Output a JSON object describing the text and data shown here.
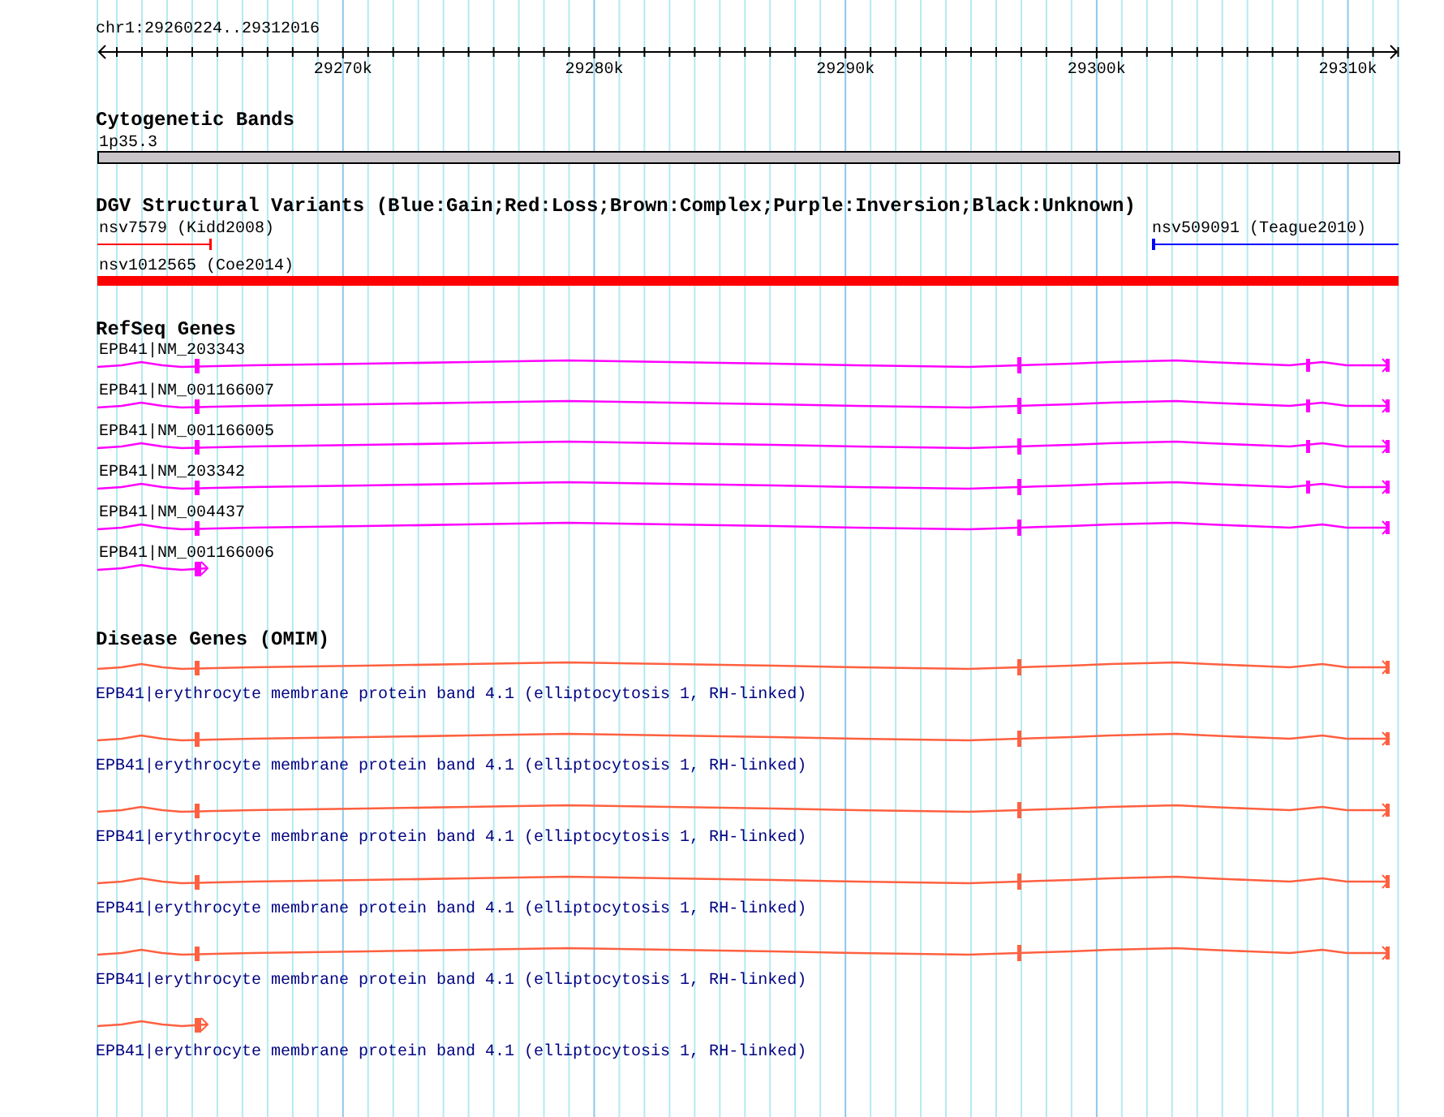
{
  "ruler": {
    "location": "chr1:29260224..29312016",
    "ticks": [
      "29270k",
      "29280k",
      "29290k",
      "29300k",
      "29310k"
    ]
  },
  "tracks": [
    {
      "kind": "bands",
      "title": "Cytogenetic Bands",
      "features": [
        {
          "label": "1p35.3"
        }
      ]
    },
    {
      "kind": "variants",
      "title": "DGV Structural Variants (Blue:Gain;Red:Loss;Brown:Complex;Purple:Inversion;Black:Unknown)",
      "features": [
        {
          "kind": "left",
          "label": "nsv7579 (Kidd2008)",
          "color": "#ff0000"
        },
        {
          "kind": "right",
          "label": "nsv509091 (Teague2010)",
          "color": "#0000ff"
        },
        {
          "kind": "span",
          "label": "nsv1012565 (Coe2014)",
          "color": "#ff0000"
        }
      ]
    },
    {
      "kind": "genes",
      "title": "RefSeq Genes",
      "features": [
        {
          "kind": "full",
          "label": "EPB41|NM_203343"
        },
        {
          "kind": "full",
          "label": "EPB41|NM_001166007"
        },
        {
          "kind": "full",
          "label": "EPB41|NM_001166005"
        },
        {
          "kind": "full",
          "label": "EPB41|NM_203342"
        },
        {
          "kind": "skip",
          "label": "EPB41|NM_004437"
        },
        {
          "kind": "short",
          "label": "EPB41|NM_001166006"
        }
      ]
    },
    {
      "kind": "disease",
      "title": "Disease Genes (OMIM)",
      "features": [
        {
          "kind": "skip",
          "label": "EPB41|erythrocyte membrane protein band 4.1 (elliptocytosis 1, RH-linked)"
        },
        {
          "kind": "skip",
          "label": "EPB41|erythrocyte membrane protein band 4.1 (elliptocytosis 1, RH-linked)"
        },
        {
          "kind": "skip",
          "label": "EPB41|erythrocyte membrane protein band 4.1 (elliptocytosis 1, RH-linked)"
        },
        {
          "kind": "skip",
          "label": "EPB41|erythrocyte membrane protein band 4.1 (elliptocytosis 1, RH-linked)"
        },
        {
          "kind": "skip",
          "label": "EPB41|erythrocyte membrane protein band 4.1 (elliptocytosis 1, RH-linked)"
        },
        {
          "kind": "short",
          "label": "EPB41|erythrocyte membrane protein band 4.1 (elliptocytosis 1, RH-linked)"
        }
      ]
    }
  ]
}
